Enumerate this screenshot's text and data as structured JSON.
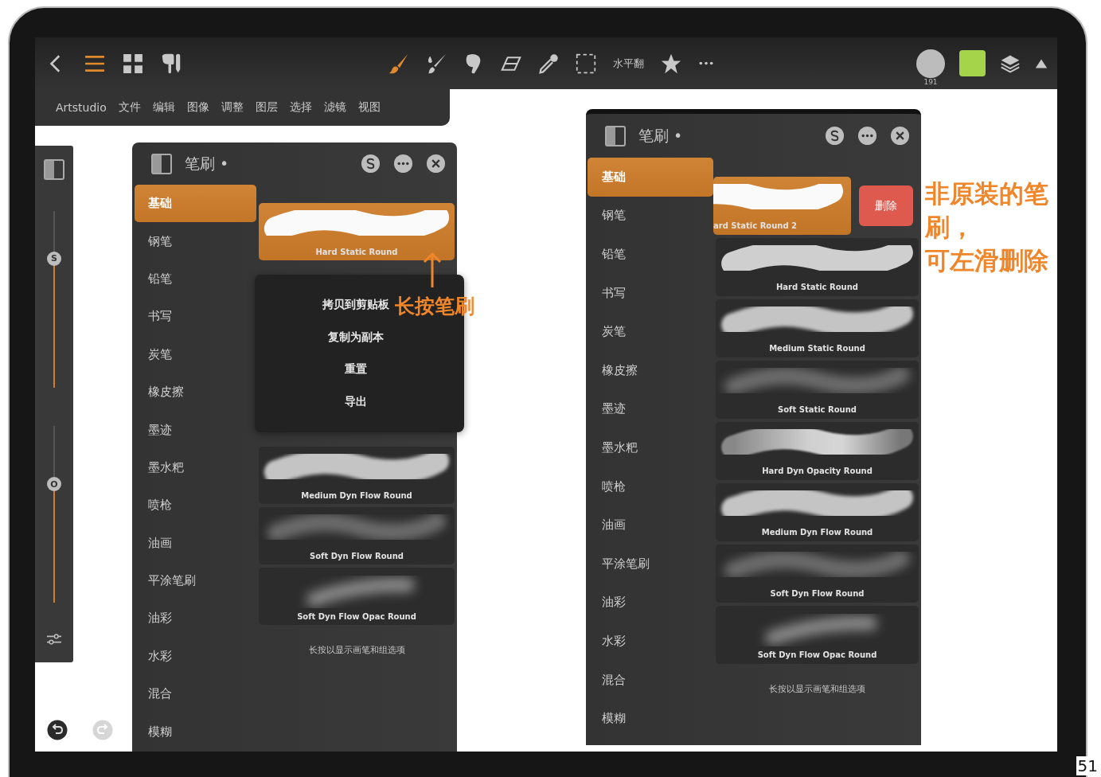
{
  "toolbar": {
    "nav": [
      {
        "kind": "back",
        "selected": false
      },
      {
        "kind": "menu",
        "selected": true
      },
      {
        "kind": "grid",
        "selected": false
      },
      {
        "kind": "hand",
        "selected": false
      }
    ],
    "tools": [
      {
        "kind": "brush",
        "selected": true
      },
      {
        "kind": "smudge",
        "selected": false
      },
      {
        "kind": "finger",
        "selected": false
      },
      {
        "kind": "eraser",
        "selected": false
      },
      {
        "kind": "picker",
        "selected": false
      },
      {
        "kind": "select",
        "selected": false
      },
      {
        "kind": "text",
        "label": "水平翻",
        "selected": false
      },
      {
        "kind": "star",
        "selected": false
      },
      {
        "kind": "more",
        "selected": false
      }
    ],
    "brush_size": "191",
    "color": "#a5d34a"
  },
  "menu_bar": [
    "Artstudio",
    "文件",
    "编辑",
    "图像",
    "调整",
    "图层",
    "选择",
    "滤镜",
    "视图"
  ],
  "side_strip": {
    "sliders": [
      {
        "label": "S",
        "level": 0.73
      },
      {
        "label": "O",
        "level": 0.67
      }
    ],
    "redo_disabled": true
  },
  "panels": [
    {
      "title": "笔刷 •",
      "categories": [
        {
          "label": "基础",
          "selected": true
        },
        {
          "label": "钢笔",
          "selected": false
        },
        {
          "label": "铅笔",
          "selected": false
        },
        {
          "label": "书写",
          "selected": false
        },
        {
          "label": "炭笔",
          "selected": false
        },
        {
          "label": "橡皮擦",
          "selected": false
        },
        {
          "label": "墨迹",
          "selected": false
        },
        {
          "label": "墨水粑",
          "selected": false
        },
        {
          "label": "喷枪",
          "selected": false
        },
        {
          "label": "油画",
          "selected": false
        },
        {
          "label": "平涂笔刷",
          "selected": false
        },
        {
          "label": "油彩",
          "selected": false
        },
        {
          "label": "水彩",
          "selected": false
        },
        {
          "label": "混合",
          "selected": false
        },
        {
          "label": "模糊",
          "selected": false
        }
      ],
      "brushes": [
        {
          "name": "Hard Static Round",
          "kind": "hard",
          "selected": true,
          "swiped": false
        },
        {
          "name": "Medium Dyn Flow Round",
          "kind": "medium",
          "selected": false,
          "swiped": false
        },
        {
          "name": "Soft Dyn Flow Round",
          "kind": "soft",
          "selected": false,
          "swiped": false
        },
        {
          "name": "Soft Dyn Flow Opac Round",
          "kind": "spot",
          "selected": false,
          "swiped": false
        }
      ],
      "hint": "长按以显示画笔和组选项",
      "context_menu": [
        "拷贝到剪贴板",
        "复制为副本",
        "重置",
        "导出"
      ],
      "annotation": "长按笔刷"
    },
    {
      "title": "笔刷 •",
      "categories": [
        {
          "label": "基础",
          "selected": true
        },
        {
          "label": "钢笔",
          "selected": false
        },
        {
          "label": "铅笔",
          "selected": false
        },
        {
          "label": "书写",
          "selected": false
        },
        {
          "label": "炭笔",
          "selected": false
        },
        {
          "label": "橡皮擦",
          "selected": false
        },
        {
          "label": "墨迹",
          "selected": false
        },
        {
          "label": "墨水粑",
          "selected": false
        },
        {
          "label": "喷枪",
          "selected": false
        },
        {
          "label": "油画",
          "selected": false
        },
        {
          "label": "平涂笔刷",
          "selected": false
        },
        {
          "label": "油彩",
          "selected": false
        },
        {
          "label": "水彩",
          "selected": false
        },
        {
          "label": "混合",
          "selected": false
        },
        {
          "label": "模糊",
          "selected": false
        }
      ],
      "brushes": [
        {
          "name": "ard Static Round 2",
          "kind": "hard",
          "selected": true,
          "swiped": true,
          "delete_label": "删除"
        },
        {
          "name": "Hard Static Round",
          "kind": "hard",
          "selected": false,
          "swiped": false
        },
        {
          "name": "Medium Static Round",
          "kind": "medium",
          "selected": false,
          "swiped": false
        },
        {
          "name": "Soft Static Round",
          "kind": "soft",
          "selected": false,
          "swiped": false
        },
        {
          "name": "Hard Dyn Opacity Round",
          "kind": "opacity",
          "selected": false,
          "swiped": false
        },
        {
          "name": "Medium Dyn Flow Round",
          "kind": "medium",
          "selected": false,
          "swiped": false
        },
        {
          "name": "Soft Dyn Flow Round",
          "kind": "soft",
          "selected": false,
          "swiped": false
        },
        {
          "name": "Soft Dyn Flow Opac Round",
          "kind": "spot",
          "selected": false,
          "swiped": false
        }
      ],
      "hint": "长按以显示画笔和组选项"
    }
  ],
  "side_note": [
    "非原装的笔刷，",
    "可左滑删除"
  ],
  "page_number": "51"
}
